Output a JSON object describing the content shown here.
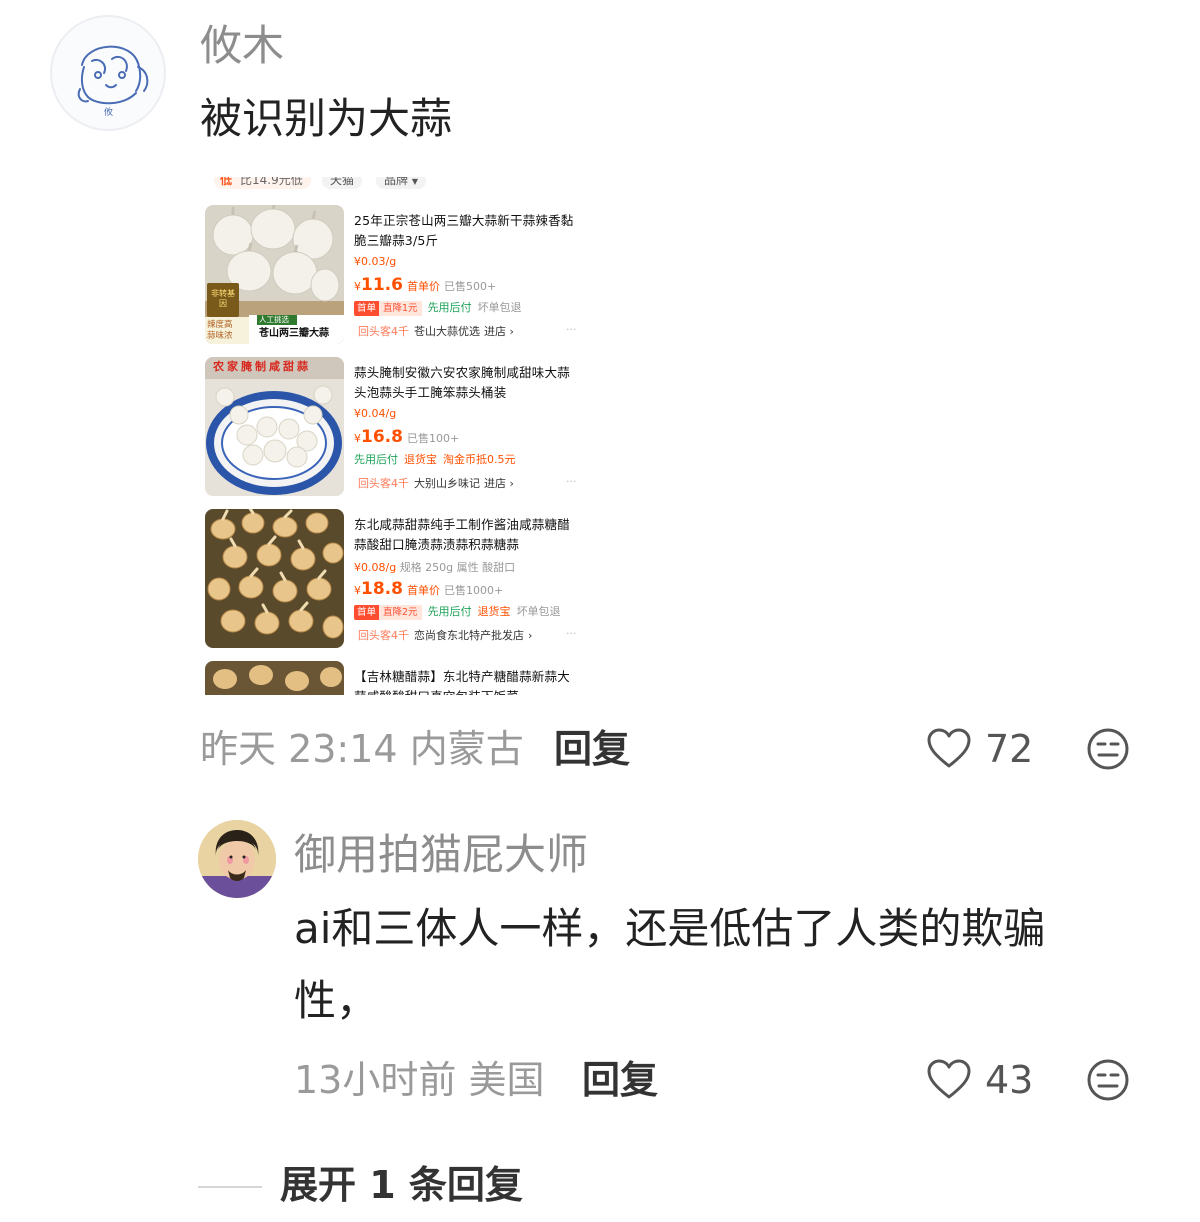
{
  "comment": {
    "username": "攸木",
    "text": "被识别为大蒜",
    "time": "昨天 23:14",
    "location": "内蒙古",
    "reply_label": "回复",
    "likes": "72"
  },
  "screenshot": {
    "filter_bar": {
      "price_chip": "比14.9元低",
      "tmall_chip": "天猫",
      "brand_chip": "品牌"
    },
    "products": [
      {
        "title": "25年正宗苍山两三瓣大蒜新干蒜辣香黏脆三瓣蒜3/5斤",
        "unit_price": "¥0.03/g",
        "unit_extra": "",
        "currency": "¥",
        "price": "11.6",
        "price_note": "首单价",
        "sold": "已售500+",
        "tags": [
          "首单",
          "直降1元",
          "先用后付",
          "坏单包退"
        ],
        "repeat": "回头客4千",
        "shop": "苍山大蒜优选",
        "enter": "进店 ›",
        "thumb_labels": [
          "非转基因",
          "辣度高",
          "蒜味浓",
          "人工挑选",
          "苍山两三瓣大蒜"
        ]
      },
      {
        "title": "蒜头腌制安徽六安农家腌制咸甜味大蒜头泡蒜头手工腌笨蒜头桶装",
        "unit_price": "¥0.04/g",
        "unit_extra": "",
        "currency": "¥",
        "price": "16.8",
        "price_note": "",
        "sold": "已售100+",
        "tags": [
          "先用后付",
          "退货宝",
          "淘金币抵0.5元"
        ],
        "repeat": "回头客4千",
        "shop": "大别山乡味记",
        "enter": "进店 ›",
        "thumb_labels": [
          "农家腌制咸甜蒜"
        ]
      },
      {
        "title": "东北咸蒜甜蒜纯手工制作酱油咸蒜糖醋蒜酸甜口腌渍蒜渍蒜积蒜糖蒜",
        "unit_price": "¥0.08/g",
        "unit_extra": "规格 250g  属性 酸甜口",
        "currency": "¥",
        "price": "18.8",
        "price_note": "首单价",
        "sold": "已售1000+",
        "tags": [
          "首单",
          "直降2元",
          "先用后付",
          "退货宝",
          "坏单包退"
        ],
        "repeat": "回头客4千",
        "shop": "恋尚食东北特产批发店",
        "enter": "›",
        "thumb_labels": []
      },
      {
        "title": "【吉林糖醋蒜】东北特产糖醋蒜新蒜大蒜咸酸酸甜口真空包装下饭菜"
      }
    ]
  },
  "reply": {
    "username": "御用拍猫屁大师",
    "text_line1": "ai和三体人一样，还是低估了人类的欺骗",
    "text_line2": "性，",
    "time": "13小时前",
    "location": "美国",
    "reply_label": "回复",
    "likes": "43"
  },
  "expand_label": "展开 1 条回复",
  "colors": {
    "meta_grey": "#9a9a9a",
    "username_grey": "#8d8d8d",
    "price_orange": "#ff5000",
    "green_tag": "#20a35a"
  },
  "icons": [
    "heart-icon",
    "neutral-face-icon",
    "chevron-down-icon"
  ]
}
